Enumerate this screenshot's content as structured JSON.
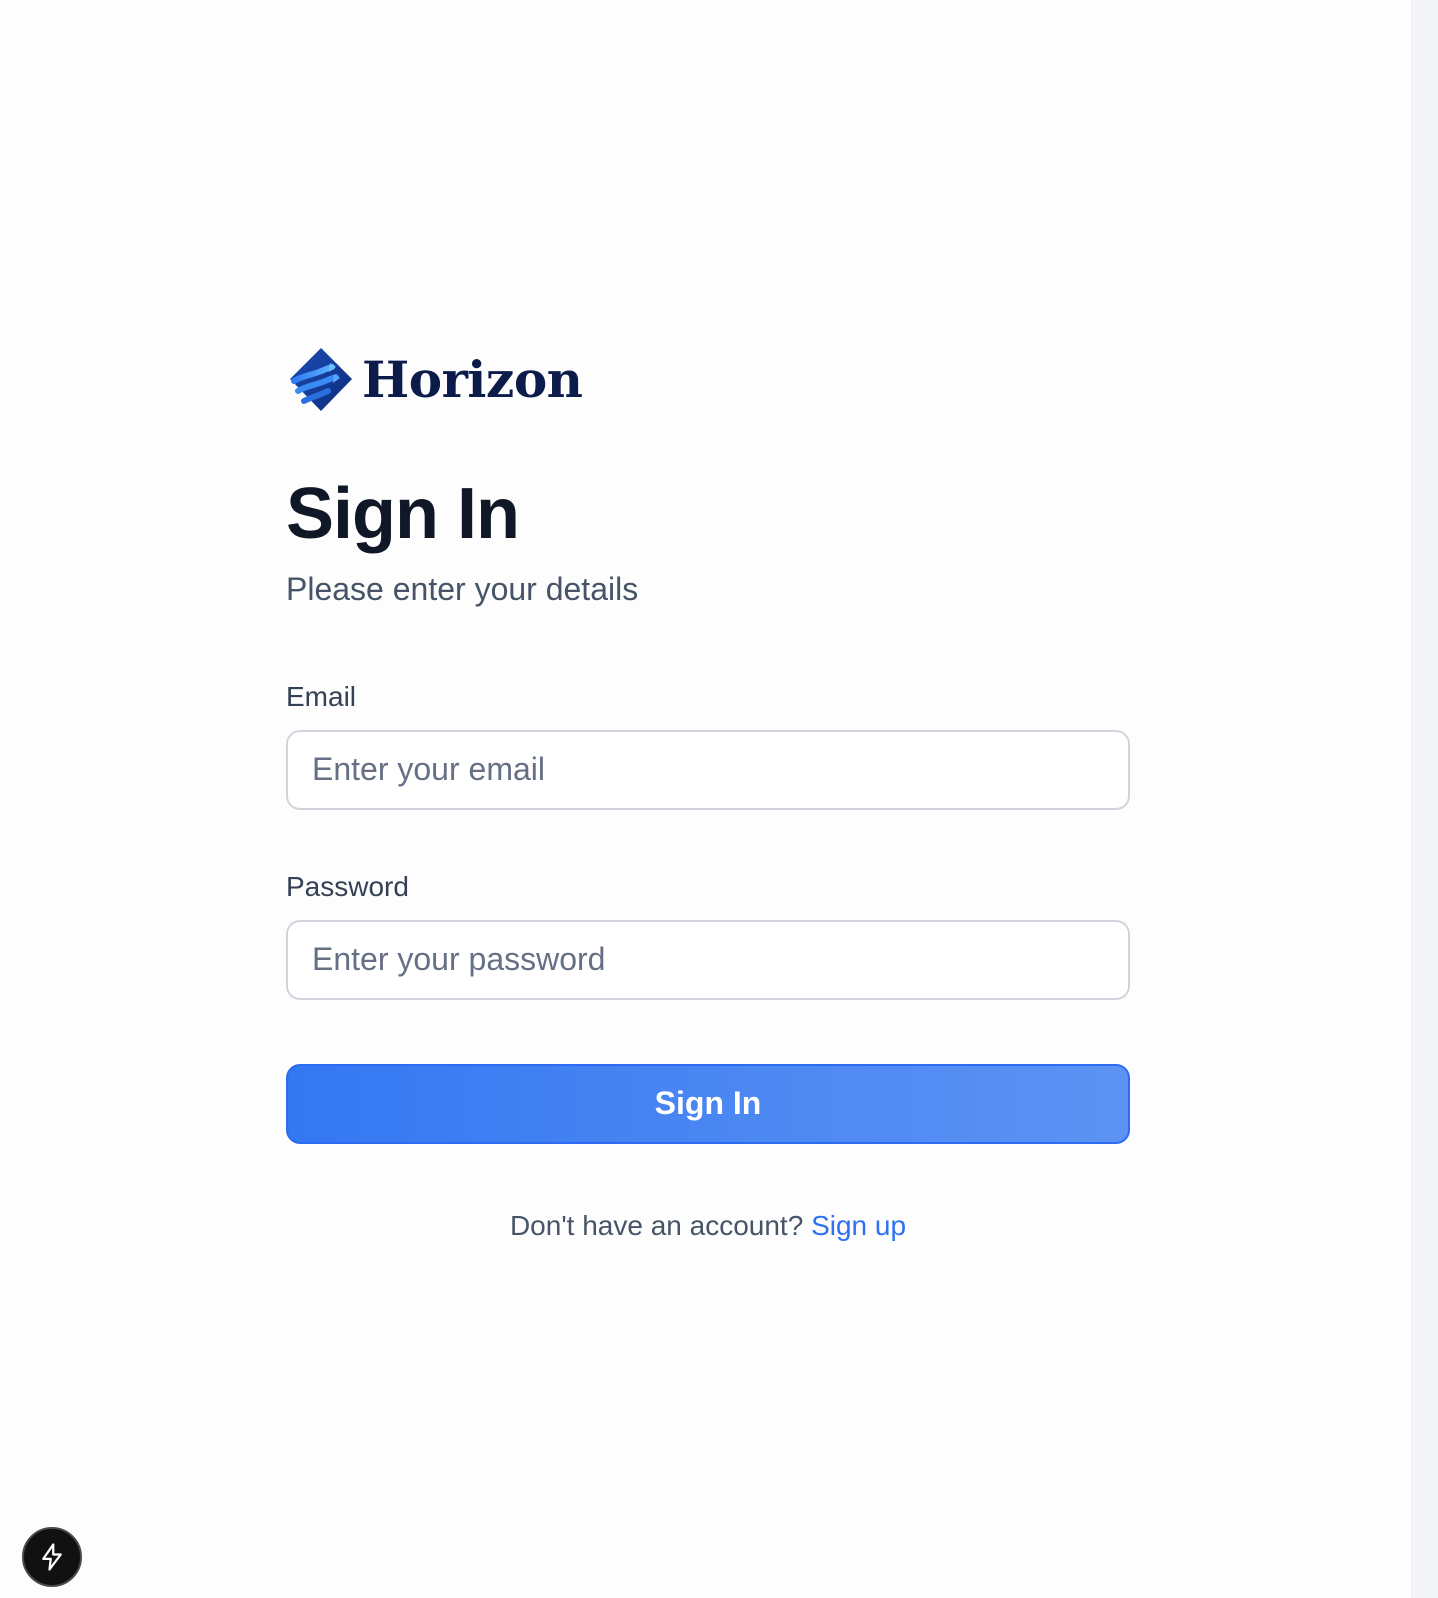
{
  "brand": {
    "name": "Horizon",
    "icon": "horizon-logo-icon"
  },
  "header": {
    "title": "Sign In",
    "subtitle": "Please enter your details"
  },
  "form": {
    "email": {
      "label": "Email",
      "placeholder": "Enter your email",
      "value": ""
    },
    "password": {
      "label": "Password",
      "placeholder": "Enter your password",
      "value": ""
    },
    "submit_label": "Sign In"
  },
  "footer": {
    "prompt": "Don't have an account?",
    "link_label": "Sign up"
  },
  "dev_tools": {
    "icon": "lightning-bolt-icon"
  },
  "colors": {
    "brand_navy": "#0b1b4a",
    "accent_blue": "#3377f2",
    "link_blue": "#2f72f0",
    "input_border": "#d0d5dd"
  }
}
